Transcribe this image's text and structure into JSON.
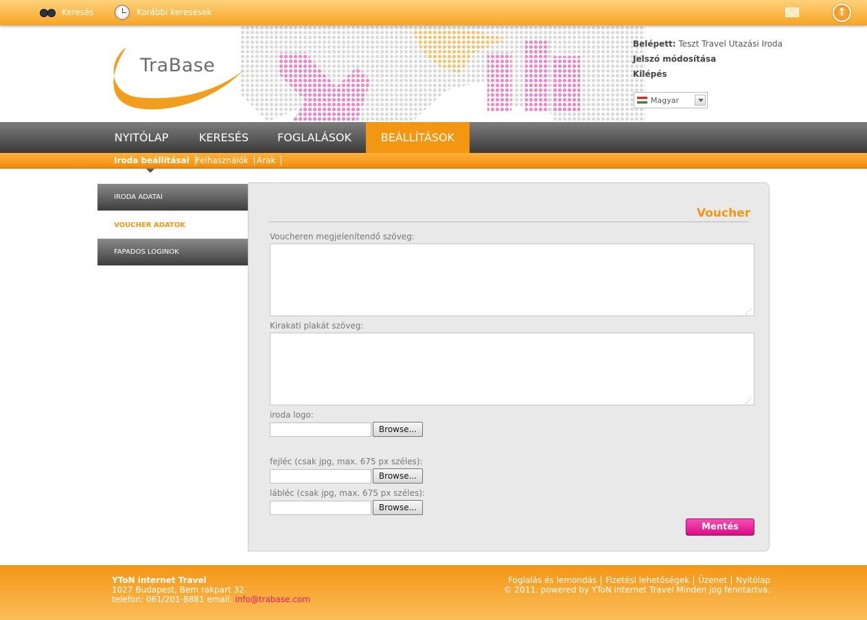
{
  "topbar": {
    "search_label": "Keresés",
    "history_label": "Korábbi keresések"
  },
  "header": {
    "logo_text": "TraBase",
    "logged_in_label": "Belépett:",
    "logged_in_user": "Teszt Travel Utazási Iroda",
    "change_password": "Jelszó módosítása",
    "logout": "Kilépés",
    "language": "Magyar"
  },
  "mainnav": {
    "items": [
      "NYITÓLAP",
      "KERESÉS",
      "FOGLALÁSOK",
      "BEÁLLÍTÁSOK"
    ],
    "active": "BEÁLLÍTÁSOK"
  },
  "subnav": {
    "items": [
      "Iroda beállításai",
      "Felhasználók",
      "Árak"
    ]
  },
  "sidemenu": {
    "items": [
      "IRODA ADATAI",
      "VOUCHER ADATOK",
      "FAPADOS LOGINOK"
    ],
    "active": "VOUCHER ADATOK"
  },
  "form": {
    "title": "Voucher",
    "voucher_text_label": "Voucheren megjelenítendő szöveg:",
    "voucher_text_value": "",
    "poster_text_label": "Kirakati plakát szöveg:",
    "poster_text_value": "",
    "logo_label": "iroda logo:",
    "header_label": "fejléc (csak jpg, max. 675 px széles):",
    "footer_label": "lábléc (csak jpg, max. 675 px széles):",
    "browse_label": "Browse...",
    "save_label": "Mentés"
  },
  "footer": {
    "company": "YToN internet Travel",
    "address": "1027 Budapest, Bem rakpart 32.",
    "contact_prefix": "telefon: 061/201-8881 email:",
    "email": "info@trabase.com",
    "links": [
      "Foglalás és lemondás",
      "Fizetési lehetőségek",
      "Üzenet",
      "Nyitólap"
    ],
    "copyright": "© 2011. powered by YToN internet Travel Minden jog fenntartva."
  },
  "colors": {
    "accent_orange": "#f39611",
    "save_pink": "#e3187a",
    "nav_dark": "#3b3b3b"
  }
}
